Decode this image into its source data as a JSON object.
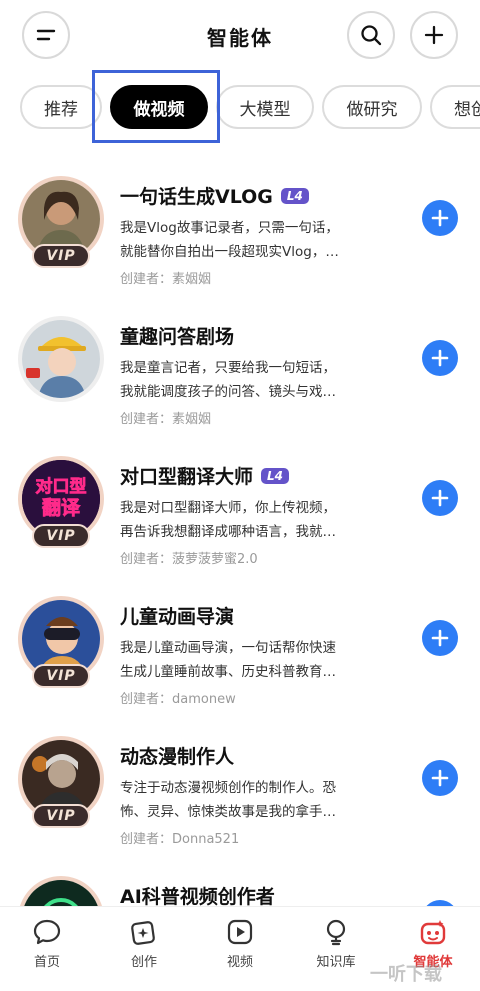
{
  "header": {
    "title": "智能体",
    "menu_icon": "collapse-icon",
    "search_icon": "search-icon",
    "add_icon": "plus-icon"
  },
  "tabs": [
    {
      "label": "推荐"
    },
    {
      "label": "做视频",
      "active": true
    },
    {
      "label": "大模型"
    },
    {
      "label": "做研究"
    },
    {
      "label": "想创"
    }
  ],
  "agents": [
    {
      "name": "一句话生成VLOG",
      "level": "L4",
      "vip": "VIP",
      "desc_line1": "我是Vlog故事记录者，只需一句话，",
      "desc_line2": "就能替你自拍出一段超现实Vlog，…",
      "creator": "创建者：素姻姻"
    },
    {
      "name": "童趣问答剧场",
      "level": "",
      "vip": "",
      "desc_line1": "我是童言记者，只要给我一句短话，",
      "desc_line2": "我就能调度孩子的问答、镜头与戏…",
      "creator": "创建者：素姻姻"
    },
    {
      "name": "对口型翻译大师",
      "level": "L4",
      "vip": "VIP",
      "avatar_text_1": "对口型",
      "avatar_text_2": "翻译",
      "desc_line1": "我是对口型翻译大师，你上传视频，",
      "desc_line2": "再告诉我想翻译成哪种语言，我就…",
      "creator": "创建者：菠萝菠萝蜜2.0"
    },
    {
      "name": "儿童动画导演",
      "level": "",
      "vip": "VIP",
      "desc_line1": "我是儿童动画导演，一句话帮你快速",
      "desc_line2": "生成儿童睡前故事、历史科普教育…",
      "creator": "创建者：damonew"
    },
    {
      "name": "动态漫制作人",
      "level": "",
      "vip": "VIP",
      "desc_line1": "专注于动态漫视频创作的制作人。恐",
      "desc_line2": "怖、灵异、惊悚类故事是我的拿手…",
      "creator": "创建者：Donna521"
    },
    {
      "name": "AI科普视频创作者",
      "level": "",
      "vip": "",
      "desc_line1": "",
      "desc_line2": "",
      "creator": ""
    }
  ],
  "bottom_nav": [
    {
      "label": "首页",
      "icon": "chat-bubble-icon"
    },
    {
      "label": "创作",
      "icon": "create-cards-icon"
    },
    {
      "label": "视频",
      "icon": "video-play-icon"
    },
    {
      "label": "知识库",
      "icon": "lightbulb-icon"
    },
    {
      "label": "智能体",
      "icon": "agent-bot-icon",
      "active": true
    }
  ],
  "watermark": "一听下载",
  "colors": {
    "accent_blue": "#2e7df6",
    "level_badge": "#6453c9",
    "active_nav": "#e03a3a",
    "highlight_box": "#3d63d8"
  }
}
